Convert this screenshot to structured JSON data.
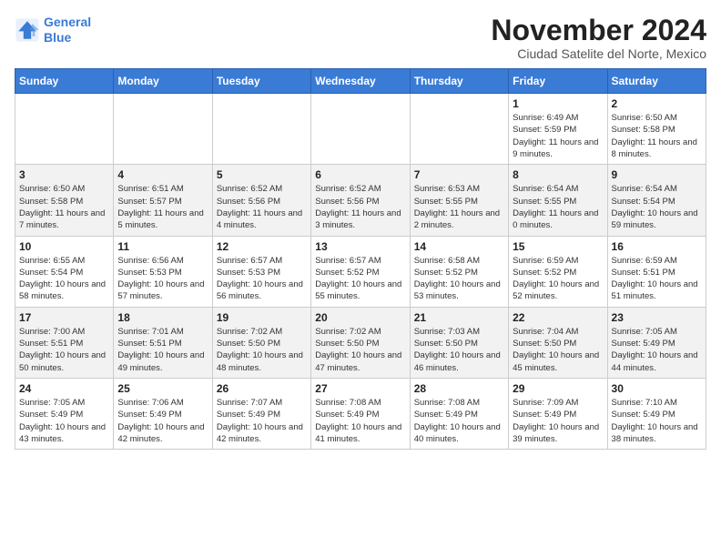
{
  "logo": {
    "line1": "General",
    "line2": "Blue"
  },
  "title": "November 2024",
  "subtitle": "Ciudad Satelite del Norte, Mexico",
  "weekdays": [
    "Sunday",
    "Monday",
    "Tuesday",
    "Wednesday",
    "Thursday",
    "Friday",
    "Saturday"
  ],
  "weeks": [
    [
      {
        "day": "",
        "info": ""
      },
      {
        "day": "",
        "info": ""
      },
      {
        "day": "",
        "info": ""
      },
      {
        "day": "",
        "info": ""
      },
      {
        "day": "",
        "info": ""
      },
      {
        "day": "1",
        "info": "Sunrise: 6:49 AM\nSunset: 5:59 PM\nDaylight: 11 hours and 9 minutes."
      },
      {
        "day": "2",
        "info": "Sunrise: 6:50 AM\nSunset: 5:58 PM\nDaylight: 11 hours and 8 minutes."
      }
    ],
    [
      {
        "day": "3",
        "info": "Sunrise: 6:50 AM\nSunset: 5:58 PM\nDaylight: 11 hours and 7 minutes."
      },
      {
        "day": "4",
        "info": "Sunrise: 6:51 AM\nSunset: 5:57 PM\nDaylight: 11 hours and 5 minutes."
      },
      {
        "day": "5",
        "info": "Sunrise: 6:52 AM\nSunset: 5:56 PM\nDaylight: 11 hours and 4 minutes."
      },
      {
        "day": "6",
        "info": "Sunrise: 6:52 AM\nSunset: 5:56 PM\nDaylight: 11 hours and 3 minutes."
      },
      {
        "day": "7",
        "info": "Sunrise: 6:53 AM\nSunset: 5:55 PM\nDaylight: 11 hours and 2 minutes."
      },
      {
        "day": "8",
        "info": "Sunrise: 6:54 AM\nSunset: 5:55 PM\nDaylight: 11 hours and 0 minutes."
      },
      {
        "day": "9",
        "info": "Sunrise: 6:54 AM\nSunset: 5:54 PM\nDaylight: 10 hours and 59 minutes."
      }
    ],
    [
      {
        "day": "10",
        "info": "Sunrise: 6:55 AM\nSunset: 5:54 PM\nDaylight: 10 hours and 58 minutes."
      },
      {
        "day": "11",
        "info": "Sunrise: 6:56 AM\nSunset: 5:53 PM\nDaylight: 10 hours and 57 minutes."
      },
      {
        "day": "12",
        "info": "Sunrise: 6:57 AM\nSunset: 5:53 PM\nDaylight: 10 hours and 56 minutes."
      },
      {
        "day": "13",
        "info": "Sunrise: 6:57 AM\nSunset: 5:52 PM\nDaylight: 10 hours and 55 minutes."
      },
      {
        "day": "14",
        "info": "Sunrise: 6:58 AM\nSunset: 5:52 PM\nDaylight: 10 hours and 53 minutes."
      },
      {
        "day": "15",
        "info": "Sunrise: 6:59 AM\nSunset: 5:52 PM\nDaylight: 10 hours and 52 minutes."
      },
      {
        "day": "16",
        "info": "Sunrise: 6:59 AM\nSunset: 5:51 PM\nDaylight: 10 hours and 51 minutes."
      }
    ],
    [
      {
        "day": "17",
        "info": "Sunrise: 7:00 AM\nSunset: 5:51 PM\nDaylight: 10 hours and 50 minutes."
      },
      {
        "day": "18",
        "info": "Sunrise: 7:01 AM\nSunset: 5:51 PM\nDaylight: 10 hours and 49 minutes."
      },
      {
        "day": "19",
        "info": "Sunrise: 7:02 AM\nSunset: 5:50 PM\nDaylight: 10 hours and 48 minutes."
      },
      {
        "day": "20",
        "info": "Sunrise: 7:02 AM\nSunset: 5:50 PM\nDaylight: 10 hours and 47 minutes."
      },
      {
        "day": "21",
        "info": "Sunrise: 7:03 AM\nSunset: 5:50 PM\nDaylight: 10 hours and 46 minutes."
      },
      {
        "day": "22",
        "info": "Sunrise: 7:04 AM\nSunset: 5:50 PM\nDaylight: 10 hours and 45 minutes."
      },
      {
        "day": "23",
        "info": "Sunrise: 7:05 AM\nSunset: 5:49 PM\nDaylight: 10 hours and 44 minutes."
      }
    ],
    [
      {
        "day": "24",
        "info": "Sunrise: 7:05 AM\nSunset: 5:49 PM\nDaylight: 10 hours and 43 minutes."
      },
      {
        "day": "25",
        "info": "Sunrise: 7:06 AM\nSunset: 5:49 PM\nDaylight: 10 hours and 42 minutes."
      },
      {
        "day": "26",
        "info": "Sunrise: 7:07 AM\nSunset: 5:49 PM\nDaylight: 10 hours and 42 minutes."
      },
      {
        "day": "27",
        "info": "Sunrise: 7:08 AM\nSunset: 5:49 PM\nDaylight: 10 hours and 41 minutes."
      },
      {
        "day": "28",
        "info": "Sunrise: 7:08 AM\nSunset: 5:49 PM\nDaylight: 10 hours and 40 minutes."
      },
      {
        "day": "29",
        "info": "Sunrise: 7:09 AM\nSunset: 5:49 PM\nDaylight: 10 hours and 39 minutes."
      },
      {
        "day": "30",
        "info": "Sunrise: 7:10 AM\nSunset: 5:49 PM\nDaylight: 10 hours and 38 minutes."
      }
    ]
  ]
}
